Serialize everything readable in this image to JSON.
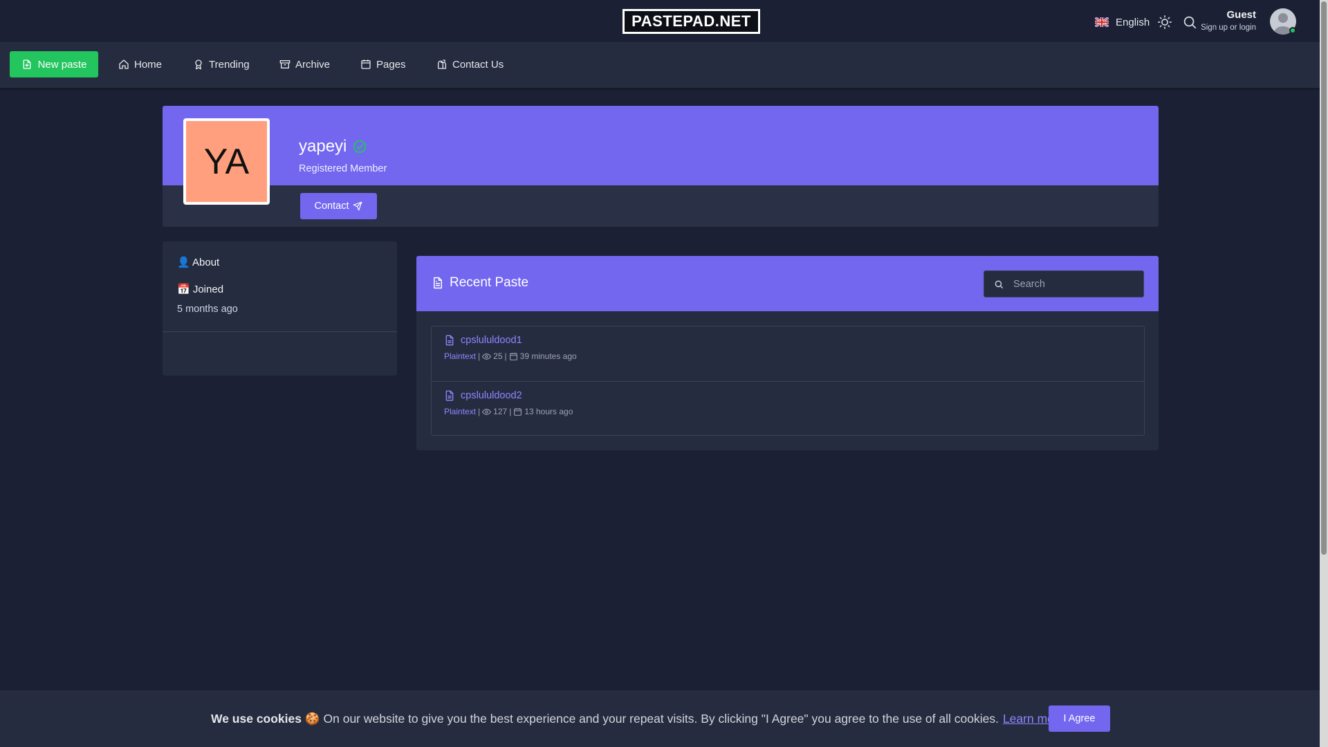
{
  "header": {
    "logo": "PASTEPAD.NET",
    "language": "English",
    "guest_name": "Guest",
    "guest_sub": "Sign up or login"
  },
  "nav": {
    "new_paste": "New paste",
    "items": [
      "Home",
      "Trending",
      "Archive",
      "Pages",
      "Contact Us"
    ]
  },
  "profile": {
    "initials": "YA",
    "username": "yapeyi",
    "role": "Registered Member",
    "contact_label": "Contact"
  },
  "about": {
    "title": "👤 About",
    "joined_label": "📅 Joined",
    "joined_value": "5 months ago"
  },
  "recent": {
    "title": "Recent Paste",
    "search_placeholder": "Search",
    "pastes": [
      {
        "title": "cpslululdood1",
        "syntax": "Plaintext",
        "views": "25",
        "time": "39 minutes ago"
      },
      {
        "title": "cpslululdood2",
        "syntax": "Plaintext",
        "views": "127",
        "time": "13 hours ago"
      }
    ]
  },
  "cookie": {
    "bold": "We use cookies 🍪",
    "text": " On our website to give you the best experience and your repeat visits. By clicking \"I Agree\" you agree to the use of all cookies.",
    "learn_more": "Learn more",
    "agree": "I Agree"
  },
  "colors": {
    "accent": "#7367f0",
    "success": "#22c55e",
    "background": "#1b2034",
    "card": "#262c40"
  }
}
